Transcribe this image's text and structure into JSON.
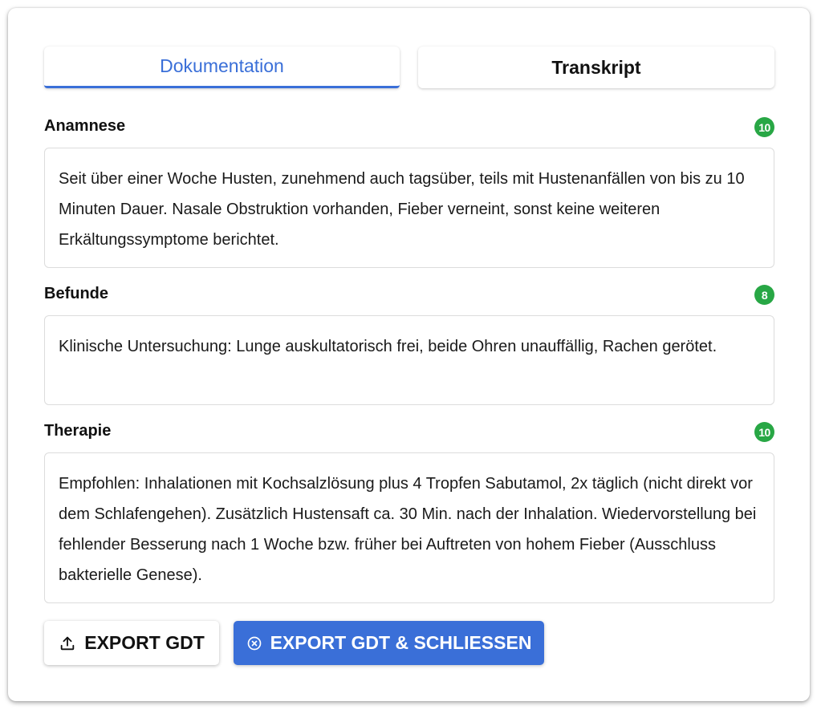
{
  "tabs": {
    "documentation": "Dokumentation",
    "transcript": "Transkript"
  },
  "sections": [
    {
      "title": "Anamnese",
      "score": "10",
      "text": "Seit über einer Woche Husten, zunehmend auch tagsüber, teils mit Hustenanfällen von bis zu 10 Minuten Dauer. Nasale Obstruktion vorhanden, Fieber verneint, sonst keine weiteren Erkältungssymptome berichtet."
    },
    {
      "title": "Befunde",
      "score": "8",
      "text": "Klinische Untersuchung: Lunge auskultatorisch frei, beide Ohren unauffällig, Rachen gerötet."
    },
    {
      "title": "Therapie",
      "score": "10",
      "text": "Empfohlen: Inhalationen mit Kochsalzlösung plus 4 Tropfen Sabutamol, 2x täglich (nicht direkt vor dem Schlafengehen). Zusätzlich Hustensaft ca. 30 Min. nach der Inhalation. Wiedervorstellung bei fehlender Besserung nach 1 Woche bzw. früher bei Auftreten von hohem Fieber (Ausschluss bakterielle Genese)."
    }
  ],
  "buttons": {
    "export": "EXPORT GDT",
    "export_close": "EXPORT GDT & SCHLIESSEN"
  },
  "icons": {
    "export": "upload-icon",
    "export_close": "circle-x-icon"
  },
  "colors": {
    "accent": "#3a6fd8",
    "score_badge": "#28a745"
  }
}
